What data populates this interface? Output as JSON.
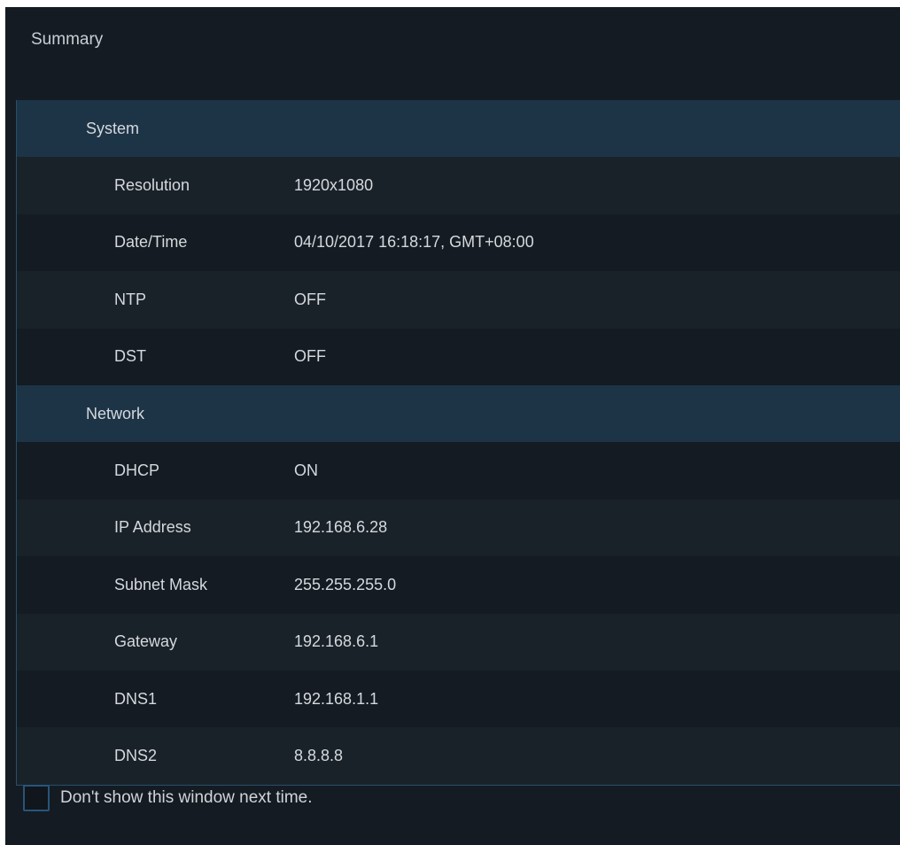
{
  "window": {
    "title": "Summary"
  },
  "sections": [
    {
      "label": "System",
      "rows": [
        {
          "label": "Resolution",
          "value": "1920x1080"
        },
        {
          "label": "Date/Time",
          "value": "04/10/2017 16:18:17, GMT+08:00"
        },
        {
          "label": "NTP",
          "value": "OFF"
        },
        {
          "label": "DST",
          "value": "OFF"
        }
      ]
    },
    {
      "label": "Network",
      "rows": [
        {
          "label": "DHCP",
          "value": "ON"
        },
        {
          "label": "IP Address",
          "value": "192.168.6.28"
        },
        {
          "label": "Subnet Mask",
          "value": "255.255.255.0"
        },
        {
          "label": "Gateway",
          "value": "192.168.6.1"
        },
        {
          "label": "DNS1",
          "value": "192.168.1.1"
        },
        {
          "label": "DNS2",
          "value": "8.8.8.8"
        }
      ]
    }
  ],
  "footer": {
    "checkbox_label": "Don't show this window next time.",
    "checked": false
  },
  "colors": {
    "window_background": "#141b22",
    "section_header": "#1d3447",
    "row_alternate": "#1a2229",
    "accent_border": "#25506b",
    "text": "#d5d9dd"
  }
}
